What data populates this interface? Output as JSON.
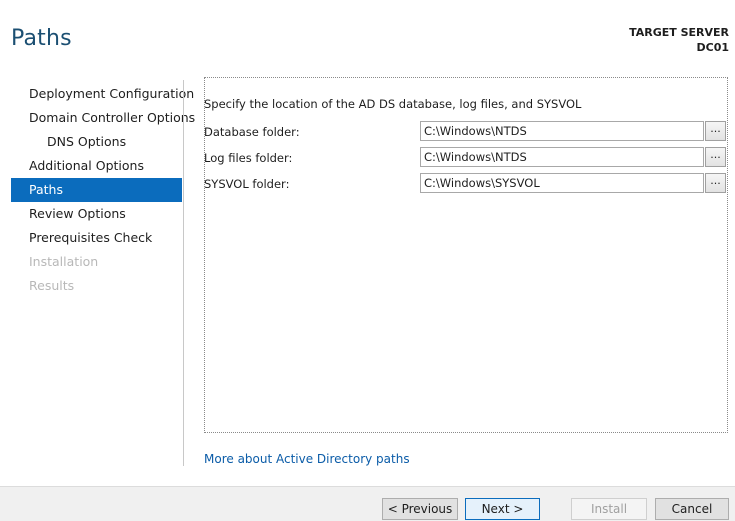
{
  "page": {
    "title": "Paths"
  },
  "target_server": {
    "label": "TARGET SERVER",
    "name": "DC01"
  },
  "nav": {
    "items": [
      {
        "label": "Deployment Configuration"
      },
      {
        "label": "Domain Controller Options"
      },
      {
        "label": "DNS Options"
      },
      {
        "label": "Additional Options"
      },
      {
        "label": "Paths"
      },
      {
        "label": "Review Options"
      },
      {
        "label": "Prerequisites Check"
      },
      {
        "label": "Installation"
      },
      {
        "label": "Results"
      }
    ],
    "active": "Paths"
  },
  "main": {
    "description": "Specify the location of the AD DS database, log files, and SYSVOL",
    "fields": [
      {
        "label": "Database folder:",
        "value": "C:\\Windows\\NTDS",
        "browse": "..."
      },
      {
        "label": "Log files folder:",
        "value": "C:\\Windows\\NTDS",
        "browse": "..."
      },
      {
        "label": "SYSVOL folder:",
        "value": "C:\\Windows\\SYSVOL",
        "browse": "..."
      }
    ],
    "link": "More about Active Directory paths"
  },
  "footer": {
    "previous": "< Previous",
    "next": "Next >",
    "install": "Install",
    "cancel": "Cancel"
  },
  "colors": {
    "accent": "#0b6cbd",
    "link": "#0b5ca8",
    "disabled_text": "#b8b8b8"
  }
}
